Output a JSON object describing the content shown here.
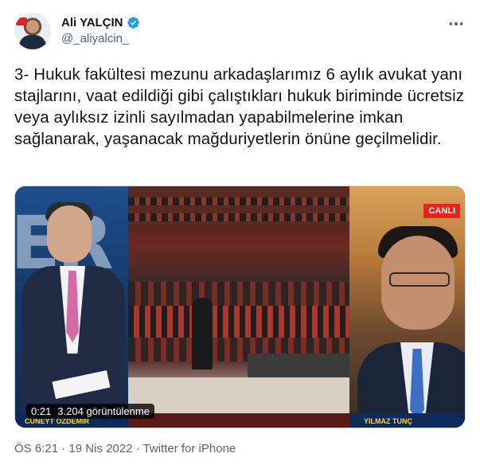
{
  "author": {
    "display_name": "Ali YALÇIN",
    "handle": "@_aliyalcin_",
    "verified": true
  },
  "tweet": {
    "text": "3- Hukuk fakültesi mezunu arkadaşlarımız 6 aylık avukat yanı stajlarını, vaat edildiği gibi çalıştıkları hukuk biriminde ücretsiz veya aylıksız izinli sayılmadan yapabilmelerine imkan sağlanarak, yaşanacak mağduriyetlerin önüne geçilmelidir."
  },
  "media": {
    "duration": "0:21",
    "views": "3.204 görüntülenme",
    "live_badge": "CANLI",
    "lower_third_left": "CÜNEYT ÖZDEMİR",
    "lower_third_right": "YILMAZ TUNÇ",
    "background_text": "ER"
  },
  "meta": {
    "time": "ÖS 6:21",
    "separator": "·",
    "date": "19 Nis 2022",
    "source": "Twitter for iPhone"
  },
  "icons": [
    "avatar",
    "verified-badge-icon",
    "more-options-icon"
  ],
  "colors": {
    "verified_blue": "#1d9bf0",
    "text_primary": "#0f1419",
    "text_secondary": "#536471",
    "live_red": "#e3261d"
  }
}
